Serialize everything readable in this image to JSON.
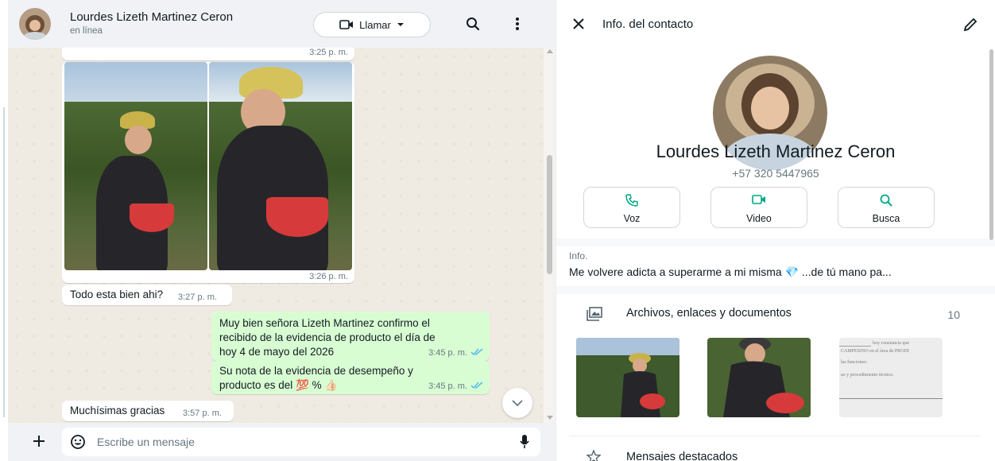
{
  "chat": {
    "header": {
      "name": "Lourdes Lizeth Martinez Ceron",
      "status": "en línea",
      "call_label": "Llamar"
    },
    "messages": [
      {
        "type": "in-time-only",
        "time": "3:25 p. m."
      },
      {
        "type": "in-images",
        "time": "3:26 p. m."
      },
      {
        "type": "in-text",
        "text": "Todo esta bien ahi?",
        "time": "3:27 p. m."
      },
      {
        "type": "out-text",
        "text_lines": [
          "Muy bien señora Lizeth Martinez confirmo el",
          "recibido de la evidencia de producto el día de",
          "hoy 4 de mayo del 2026"
        ],
        "time": "3:45 p. m."
      },
      {
        "type": "out-text",
        "text_lines": [
          "Su nota de la evidencia de desempeño y",
          "producto es del 💯 % 👍🏻"
        ],
        "time": "3:45 p. m."
      },
      {
        "type": "in-text",
        "text": "Muchísimas gracias",
        "time": "3:57 p. m."
      }
    ],
    "composer": {
      "placeholder": "Escribe un mensaje"
    }
  },
  "info": {
    "title": "Info. del contacto",
    "name": "Lourdes Lizeth Martinez Ceron",
    "phone": "+57 320 5447965",
    "actions": [
      {
        "label": "Voz",
        "icon": "phone-icon"
      },
      {
        "label": "Video",
        "icon": "video-icon"
      },
      {
        "label": "Busca",
        "icon": "search-icon"
      }
    ],
    "about_label": "Info.",
    "about_text": "Me volvere adicta a superarme a mi misma 💎 ...de tú mano pa...",
    "files_label": "Archivos, enlaces y documentos",
    "files_count": "10",
    "doc_preview_lines": [
      "hoy  constancia  que",
      "CAMPESINO en el área de PRODI",
      "las funciones:",
      "ao y procedimiento técnico."
    ],
    "starred_label": "Mensajes destacados"
  },
  "colors": {
    "accent": "#00a884",
    "outgoing_bubble": "#d9fdd3",
    "chat_bg": "#efeae2",
    "read_ticks": "#53bdeb"
  }
}
